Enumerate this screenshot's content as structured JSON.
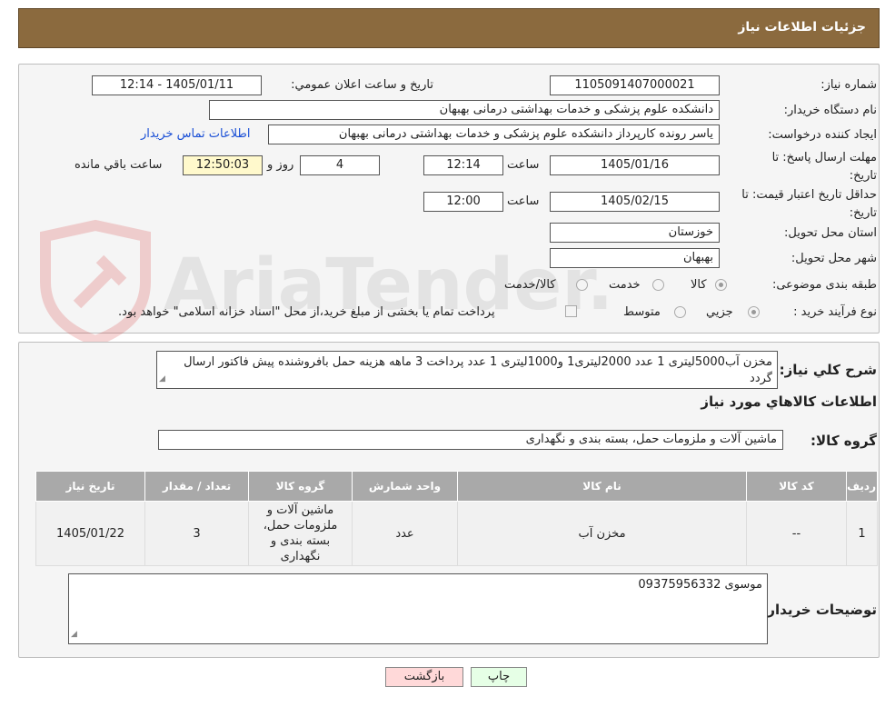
{
  "header": {
    "title": "جزئیات اطلاعات نیاز"
  },
  "watermark": {
    "text": "AriaTender.neT"
  },
  "form": {
    "need_number": {
      "label": "شماره نیاز:",
      "value": "1105091407000021"
    },
    "announce": {
      "label": "تاریخ و ساعت اعلان عمومي:",
      "value": "1405/01/11 - 12:14"
    },
    "buyer": {
      "label": "نام دستگاه خريدار:",
      "value": "دانشکده علوم پزشکی و خدمات بهداشتی  درمانی بهبهان"
    },
    "requester": {
      "label": "ايجاد کننده درخواست:",
      "value": "یاسر رونده کارپرداز دانشکده علوم پزشکی و خدمات بهداشتی  درمانی بهبهان",
      "contact_link": "اطلاعات تماس خريدار"
    },
    "deadline": {
      "label": "مهلت ارسال پاسخ: تا تاريخ:",
      "date": "1405/01/16",
      "time_label": "ساعت",
      "time": "12:14",
      "days": "4",
      "days_label": "روز و",
      "remaining": "12:50:03",
      "remaining_label": "ساعت باقي مانده"
    },
    "validity": {
      "label": "حداقل تاريخ اعتبار قيمت: تا تاريخ:",
      "date": "1405/02/15",
      "time_label": "ساعت",
      "time": "12:00"
    },
    "province": {
      "label": "استان محل تحويل:",
      "value": "خوزستان"
    },
    "city": {
      "label": "شهر محل تحويل:",
      "value": "بهبهان"
    },
    "category": {
      "label": "طبقه بندی موضوعی:",
      "options": [
        "کالا",
        "خدمت",
        "کالا/خدمت"
      ]
    },
    "process": {
      "label": "نوع فرآيند خريد :",
      "options": [
        "جزيي",
        "متوسط"
      ],
      "note": "پرداخت تمام يا بخشی از مبلغ خريد،از محل \"اسناد خزانه اسلامی\" خواهد بود."
    }
  },
  "description": {
    "label": "شرح کلي نياز:",
    "value": "مخزن آب5000لیتری 1 عدد 2000لیتری1 و1000لیتری 1 عدد پرداخت 3 ماهه هزینه حمل بافروشنده پیش فاکتور ارسال گردد"
  },
  "goods_section": {
    "title": "اطلاعات کالاهاي مورد نياز",
    "group_label": "گروه کالا:",
    "group_value": "ماشين آلات و ملزومات حمل، بسته بندی و نگهداری"
  },
  "table": {
    "headers": [
      "رديف",
      "کد کالا",
      "نام کالا",
      "واحد شمارش",
      "گروه کالا",
      "تعداد / مقدار",
      "تاريخ نياز"
    ],
    "rows": [
      {
        "row": "1",
        "code": "--",
        "name": "مخزن آب",
        "unit": "عدد",
        "group": "ماشین آلات و ملزومات حمل، بسته بندی و نگهداری",
        "qty": "3",
        "date": "1405/01/22"
      }
    ]
  },
  "buyer_notes": {
    "label": "توضيحات خريدار:",
    "value": "موسوی 09375956332"
  },
  "buttons": {
    "print": "چاپ",
    "back": "بازگشت"
  },
  "colors": {
    "header_bg": "#8b6a3e",
    "back_btn_bg": "#ffd9d9",
    "print_btn_bg": "#e6ffe6",
    "link": "#1a4fd6"
  }
}
